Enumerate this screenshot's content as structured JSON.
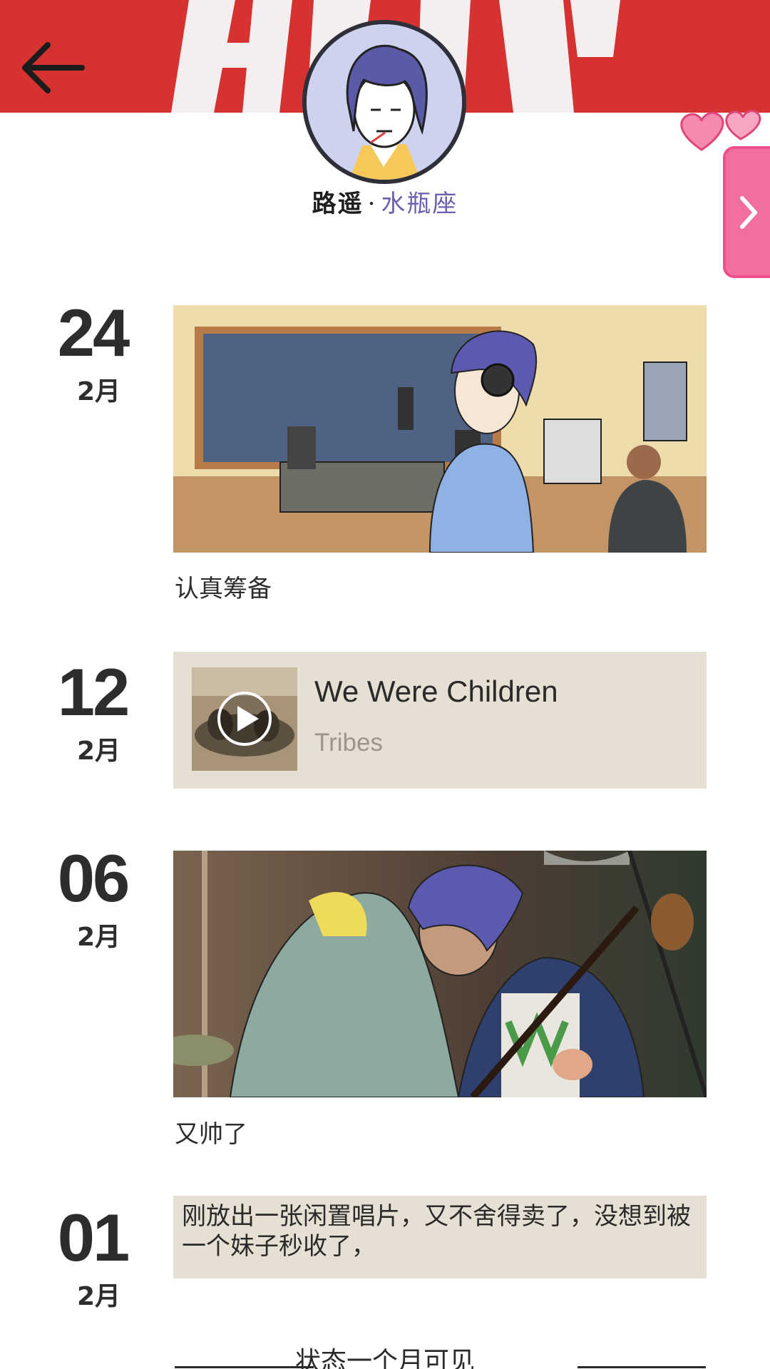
{
  "profile": {
    "name": "路遥",
    "separator": "·",
    "zodiac": "水瓶座"
  },
  "entries": [
    {
      "day": "24",
      "month": "2月",
      "caption": "认真筹备"
    },
    {
      "day": "12",
      "month": "2月",
      "music": {
        "title": "We Were Children",
        "artist": "Tribes"
      }
    },
    {
      "day": "06",
      "month": "2月",
      "caption": "又帅了"
    },
    {
      "day": "01",
      "month": "2月",
      "text": "刚放出一张闲置唱片，又不舍得卖了，没想到被一个妹子秒收了，"
    }
  ],
  "footer": {
    "note": "状态一个月可见"
  },
  "icons": {
    "back": "back-arrow-icon",
    "next": "chevron-right-icon",
    "play": "play-icon",
    "hearts": "hearts-decoration"
  },
  "colors": {
    "banner": "#d73232",
    "side_tab": "#f06ea0",
    "card_bg": "#e6dfd3",
    "zodiac_text": "#6a5fb0"
  }
}
